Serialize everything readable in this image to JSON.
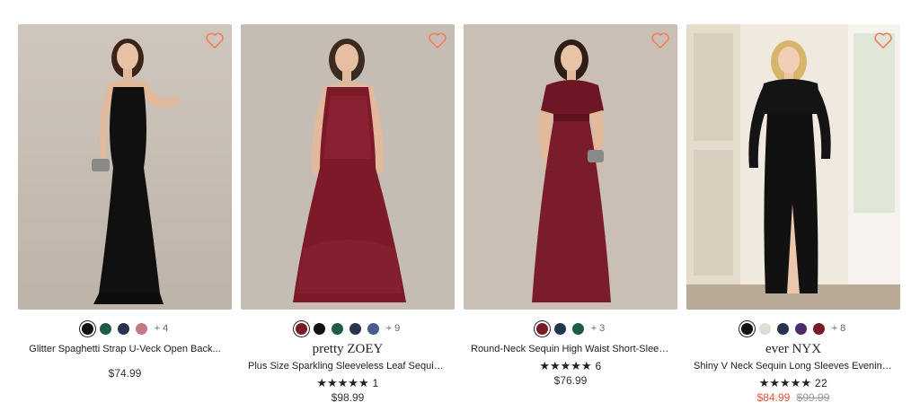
{
  "colors": {
    "accent_sale": "#e8533a",
    "heart": "#f27d63"
  },
  "products": [
    {
      "title": "Glitter Spaghetti Strap U-Veck Open Back...",
      "brand": "",
      "swatches": [
        "#111111",
        "#1e5c45",
        "#26344f",
        "#c47b86"
      ],
      "more": "+ 4",
      "rating_count": "",
      "price": "$74.99",
      "icon": "heart-outline-icon"
    },
    {
      "title": "Plus Size Sparkling Sleeveless Leaf Sequin A-Lin...",
      "brand": "pretty ZOEY",
      "swatches": [
        "#7a1a26",
        "#111111",
        "#1e5c45",
        "#26344f",
        "#4a5d8e"
      ],
      "more": "+ 9",
      "rating_count": "1",
      "price": "$98.99",
      "icon": "heart-outline-icon"
    },
    {
      "title": "Round-Neck Sequin High Waist Short-Sleeved...",
      "brand": "",
      "swatches": [
        "#7a1a26",
        "#26344f",
        "#1e5c45"
      ],
      "more": "+ 3",
      "rating_count": "6",
      "price": "$76.99",
      "icon": "heart-outline-icon"
    },
    {
      "title": "Shiny V Neck Sequin Long Sleeves Evening Dress",
      "brand": "ever NYX",
      "swatches": [
        "#111111",
        "#e2ddd4",
        "#26344f",
        "#4b2a6e",
        "#7a1a26"
      ],
      "more": "+ 8",
      "rating_count": "22",
      "sale_price": "$84.99",
      "original_price": "$99.99",
      "icon": "heart-outline-icon"
    }
  ]
}
